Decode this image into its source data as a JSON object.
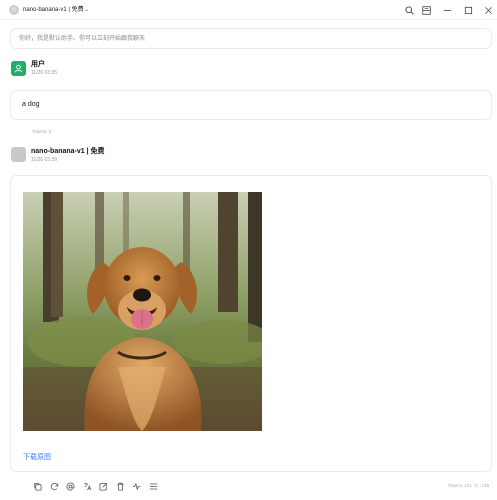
{
  "titlebar": {
    "avatar_letter": "n",
    "model_label": "nano-banana-v1 | 免费",
    "switch_glyph": "⌃⌄",
    "icons": [
      "search-icon",
      "layout-icon",
      "minimize-icon",
      "maximize-icon",
      "close-icon"
    ]
  },
  "welcome": {
    "text": "你好，我是默认助手。你可以立刻开始跟我聊天"
  },
  "user_message": {
    "name": "用户",
    "time": "11/26 03:35",
    "text": "a dog",
    "tokens": "Tokens: 2"
  },
  "assistant_message": {
    "name": "nano-banana-v1 | 免费",
    "time": "11/26 03:39",
    "image_subject": "golden retriever sitting in a forest",
    "download_label": "下载原图",
    "tokens": "Tokens: 141 ↑2 ↓139"
  },
  "actions": [
    "copy-icon",
    "regenerate-icon",
    "mention-icon",
    "translate-icon",
    "edit-icon",
    "delete-icon",
    "branch-icon",
    "menu-icon"
  ],
  "colors": {
    "user_avatar": "#22ad6a",
    "link": "#3b7cff"
  }
}
